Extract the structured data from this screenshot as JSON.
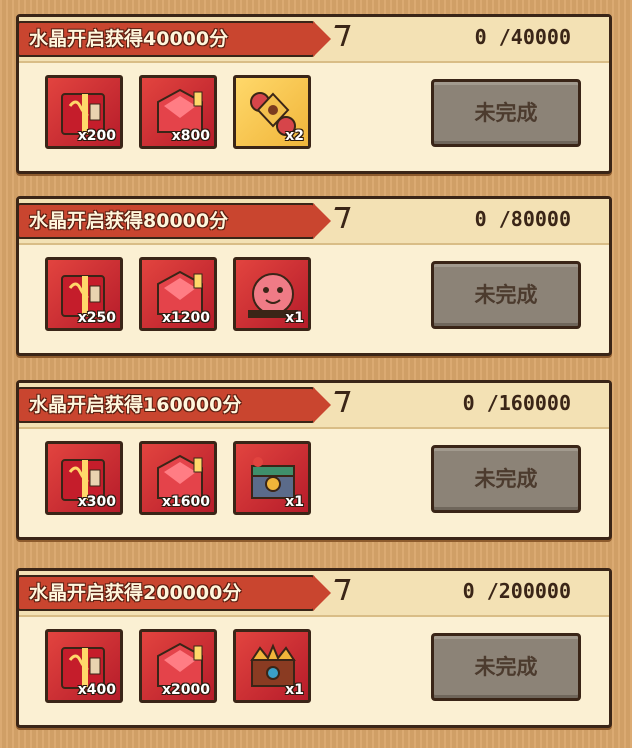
{
  "tasks": [
    {
      "title": "水晶开启获得40000分",
      "progress": "0 /40000",
      "status": "未完成",
      "rewards": [
        {
          "icon": "red-chest-icon",
          "qty": "x200"
        },
        {
          "icon": "red-gem-pack-icon",
          "qty": "x800"
        },
        {
          "icon": "gold-token-icon",
          "qty": "x2"
        }
      ]
    },
    {
      "title": "水晶开启获得80000分",
      "progress": "0 /80000",
      "status": "未完成",
      "rewards": [
        {
          "icon": "red-chest-icon",
          "qty": "x250"
        },
        {
          "icon": "red-gem-pack-icon",
          "qty": "x1200"
        },
        {
          "icon": "pink-creature-icon",
          "qty": "x1"
        }
      ]
    },
    {
      "title": "水晶开启获得160000分",
      "progress": "0 /160000",
      "status": "未完成",
      "rewards": [
        {
          "icon": "red-chest-icon",
          "qty": "x300"
        },
        {
          "icon": "red-gem-pack-icon",
          "qty": "x1600"
        },
        {
          "icon": "treasure-box-icon",
          "qty": "x1"
        }
      ]
    },
    {
      "title": "水晶开启获得200000分",
      "progress": "0 /200000",
      "status": "未完成",
      "rewards": [
        {
          "icon": "red-chest-icon",
          "qty": "x400"
        },
        {
          "icon": "red-gem-pack-icon",
          "qty": "x2000"
        },
        {
          "icon": "golden-crown-chest-icon",
          "qty": "x1"
        }
      ]
    }
  ]
}
